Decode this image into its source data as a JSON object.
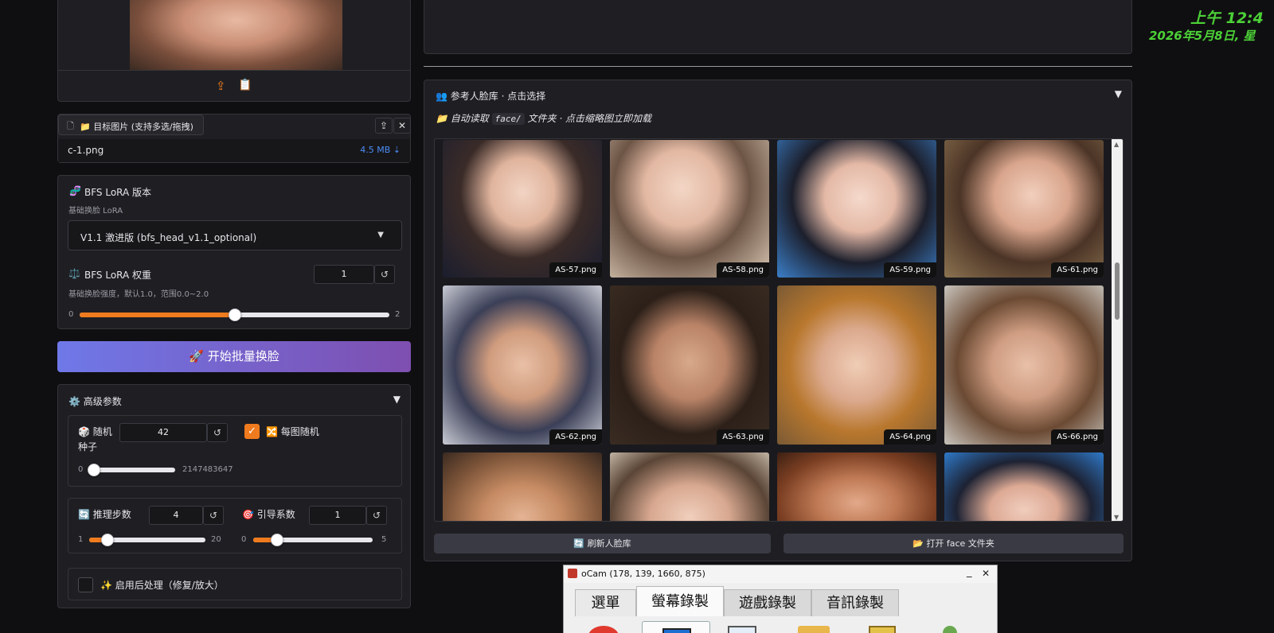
{
  "clock": {
    "time": "上午 12:4",
    "date": "2026年5月8日, 星"
  },
  "source_upload": {
    "upload_icon": "upload-icon",
    "paste_icon": "clipboard-icon"
  },
  "target_file": {
    "label": "📁 目标图片 (支持多选/拖拽)",
    "file_name": "c-1.png",
    "file_size": "4.5 MB",
    "download_glyph": "⇣"
  },
  "lora_version": {
    "title": "BFS LoRA 版本",
    "subtitle": "基础换脸 LoRA",
    "selected": "V1.1 激进版 (bfs_head_v1.1_optional)"
  },
  "lora_weight": {
    "title": "BFS LoRA 权重",
    "subtitle": "基础换脸强度，默认1.0，范围0.0~2.0",
    "value": "1",
    "min": "0",
    "max": "2",
    "fraction": 0.5
  },
  "start_button": {
    "label": "🚀 开始批量换脸"
  },
  "advanced": {
    "title": "⚙️ 高级参数",
    "seed": {
      "label_line1": "🎲 随机",
      "label_line2": "种子",
      "value": "42",
      "min": "0",
      "max": "2147483647",
      "fraction": 0.0
    },
    "random_each": {
      "label": "🔀 每图随机",
      "checked": true
    },
    "steps": {
      "label": "🔄 推理步数",
      "value": "4",
      "min": "1",
      "max": "20",
      "fraction": 0.158
    },
    "guidance": {
      "label": "🎯 引导系数",
      "value": "1",
      "min": "0",
      "max": "5",
      "fraction": 0.2
    },
    "post_process": {
      "label": "✨ 启用后处理（修复/放大）",
      "checked": false
    }
  },
  "face_library": {
    "title": "👥 参考人脸库 · 点击选择",
    "hint_prefix": "📁 自动读取",
    "hint_code": "face/",
    "hint_suffix": "文件夹 · 点击缩略图立即加载",
    "faces": [
      "AS-57.png",
      "AS-58.png",
      "AS-59.png",
      "AS-61.png",
      "AS-62.png",
      "AS-63.png",
      "AS-64.png",
      "AS-66.png"
    ],
    "refresh_label": "🔄 刷新人脸库",
    "open_folder_label": "📂 打开 face 文件夹"
  },
  "ocam": {
    "title": "oCam (178, 139, 1660, 875)",
    "min_glyph": "_",
    "close_glyph": "✕",
    "tabs": [
      "選單",
      "螢幕錄製",
      "遊戲錄製",
      "音訊錄製"
    ]
  },
  "colors": {
    "accent": "#f07b1e",
    "button_gradient_start": "#6f78e8",
    "button_gradient_end": "#7e4fb0",
    "clock": "#4cd137"
  }
}
